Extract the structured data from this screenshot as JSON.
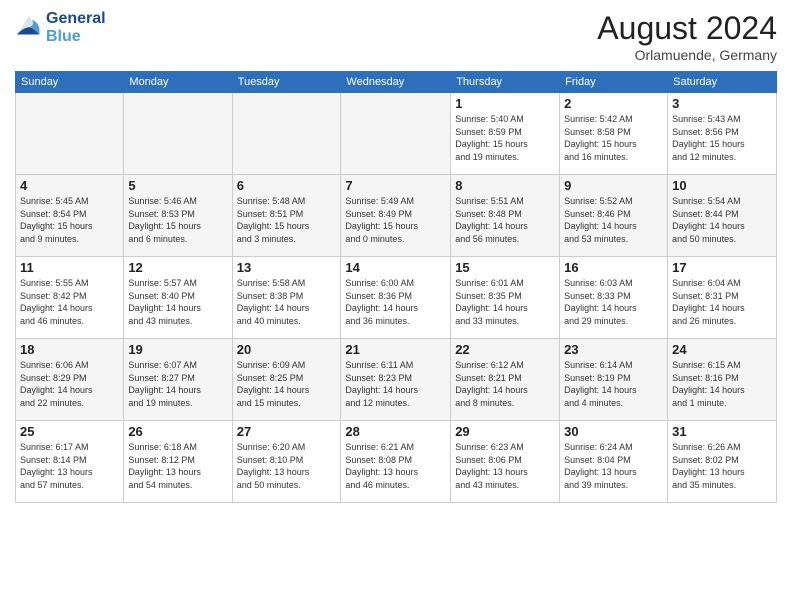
{
  "header": {
    "logo_line1": "General",
    "logo_line2": "Blue",
    "month": "August 2024",
    "location": "Orlamuende, Germany"
  },
  "days_of_week": [
    "Sunday",
    "Monday",
    "Tuesday",
    "Wednesday",
    "Thursday",
    "Friday",
    "Saturday"
  ],
  "weeks": [
    [
      {
        "day": "",
        "info": ""
      },
      {
        "day": "",
        "info": ""
      },
      {
        "day": "",
        "info": ""
      },
      {
        "day": "",
        "info": ""
      },
      {
        "day": "1",
        "info": "Sunrise: 5:40 AM\nSunset: 8:59 PM\nDaylight: 15 hours\nand 19 minutes."
      },
      {
        "day": "2",
        "info": "Sunrise: 5:42 AM\nSunset: 8:58 PM\nDaylight: 15 hours\nand 16 minutes."
      },
      {
        "day": "3",
        "info": "Sunrise: 5:43 AM\nSunset: 8:56 PM\nDaylight: 15 hours\nand 12 minutes."
      }
    ],
    [
      {
        "day": "4",
        "info": "Sunrise: 5:45 AM\nSunset: 8:54 PM\nDaylight: 15 hours\nand 9 minutes."
      },
      {
        "day": "5",
        "info": "Sunrise: 5:46 AM\nSunset: 8:53 PM\nDaylight: 15 hours\nand 6 minutes."
      },
      {
        "day": "6",
        "info": "Sunrise: 5:48 AM\nSunset: 8:51 PM\nDaylight: 15 hours\nand 3 minutes."
      },
      {
        "day": "7",
        "info": "Sunrise: 5:49 AM\nSunset: 8:49 PM\nDaylight: 15 hours\nand 0 minutes."
      },
      {
        "day": "8",
        "info": "Sunrise: 5:51 AM\nSunset: 8:48 PM\nDaylight: 14 hours\nand 56 minutes."
      },
      {
        "day": "9",
        "info": "Sunrise: 5:52 AM\nSunset: 8:46 PM\nDaylight: 14 hours\nand 53 minutes."
      },
      {
        "day": "10",
        "info": "Sunrise: 5:54 AM\nSunset: 8:44 PM\nDaylight: 14 hours\nand 50 minutes."
      }
    ],
    [
      {
        "day": "11",
        "info": "Sunrise: 5:55 AM\nSunset: 8:42 PM\nDaylight: 14 hours\nand 46 minutes."
      },
      {
        "day": "12",
        "info": "Sunrise: 5:57 AM\nSunset: 8:40 PM\nDaylight: 14 hours\nand 43 minutes."
      },
      {
        "day": "13",
        "info": "Sunrise: 5:58 AM\nSunset: 8:38 PM\nDaylight: 14 hours\nand 40 minutes."
      },
      {
        "day": "14",
        "info": "Sunrise: 6:00 AM\nSunset: 8:36 PM\nDaylight: 14 hours\nand 36 minutes."
      },
      {
        "day": "15",
        "info": "Sunrise: 6:01 AM\nSunset: 8:35 PM\nDaylight: 14 hours\nand 33 minutes."
      },
      {
        "day": "16",
        "info": "Sunrise: 6:03 AM\nSunset: 8:33 PM\nDaylight: 14 hours\nand 29 minutes."
      },
      {
        "day": "17",
        "info": "Sunrise: 6:04 AM\nSunset: 8:31 PM\nDaylight: 14 hours\nand 26 minutes."
      }
    ],
    [
      {
        "day": "18",
        "info": "Sunrise: 6:06 AM\nSunset: 8:29 PM\nDaylight: 14 hours\nand 22 minutes."
      },
      {
        "day": "19",
        "info": "Sunrise: 6:07 AM\nSunset: 8:27 PM\nDaylight: 14 hours\nand 19 minutes."
      },
      {
        "day": "20",
        "info": "Sunrise: 6:09 AM\nSunset: 8:25 PM\nDaylight: 14 hours\nand 15 minutes."
      },
      {
        "day": "21",
        "info": "Sunrise: 6:11 AM\nSunset: 8:23 PM\nDaylight: 14 hours\nand 12 minutes."
      },
      {
        "day": "22",
        "info": "Sunrise: 6:12 AM\nSunset: 8:21 PM\nDaylight: 14 hours\nand 8 minutes."
      },
      {
        "day": "23",
        "info": "Sunrise: 6:14 AM\nSunset: 8:19 PM\nDaylight: 14 hours\nand 4 minutes."
      },
      {
        "day": "24",
        "info": "Sunrise: 6:15 AM\nSunset: 8:16 PM\nDaylight: 14 hours\nand 1 minute."
      }
    ],
    [
      {
        "day": "25",
        "info": "Sunrise: 6:17 AM\nSunset: 8:14 PM\nDaylight: 13 hours\nand 57 minutes."
      },
      {
        "day": "26",
        "info": "Sunrise: 6:18 AM\nSunset: 8:12 PM\nDaylight: 13 hours\nand 54 minutes."
      },
      {
        "day": "27",
        "info": "Sunrise: 6:20 AM\nSunset: 8:10 PM\nDaylight: 13 hours\nand 50 minutes."
      },
      {
        "day": "28",
        "info": "Sunrise: 6:21 AM\nSunset: 8:08 PM\nDaylight: 13 hours\nand 46 minutes."
      },
      {
        "day": "29",
        "info": "Sunrise: 6:23 AM\nSunset: 8:06 PM\nDaylight: 13 hours\nand 43 minutes."
      },
      {
        "day": "30",
        "info": "Sunrise: 6:24 AM\nSunset: 8:04 PM\nDaylight: 13 hours\nand 39 minutes."
      },
      {
        "day": "31",
        "info": "Sunrise: 6:26 AM\nSunset: 8:02 PM\nDaylight: 13 hours\nand 35 minutes."
      }
    ]
  ]
}
